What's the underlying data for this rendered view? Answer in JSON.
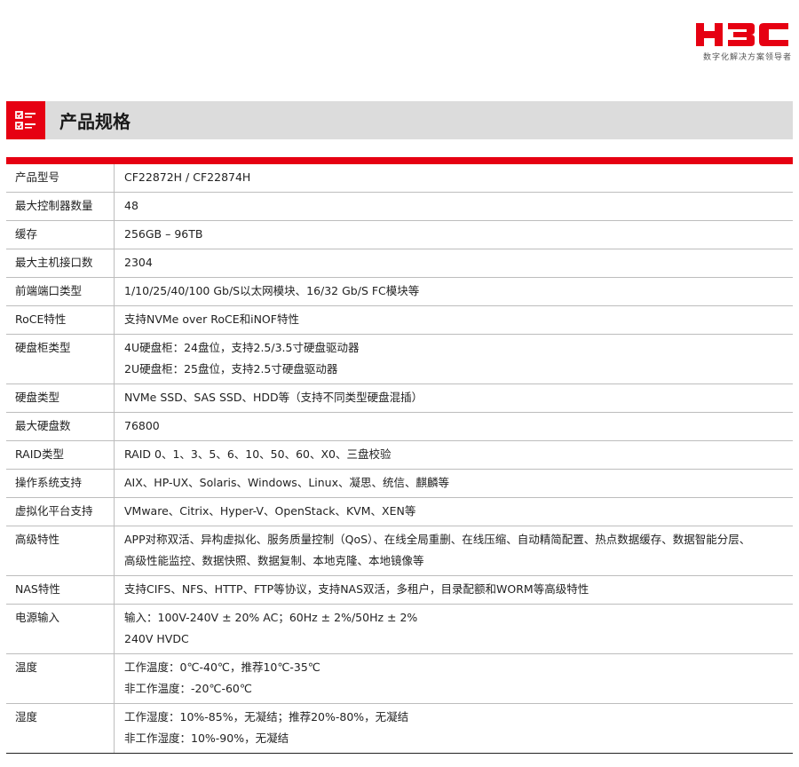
{
  "brand": {
    "logo_text": "H3C",
    "tagline": "数字化解决方案领导者",
    "accent_color": "#e60012"
  },
  "section": {
    "icon": "checklist-icon",
    "title": "产品规格"
  },
  "specs": [
    {
      "label": "产品型号",
      "lines": [
        "CF22872H  /  CF22874H"
      ]
    },
    {
      "label": "最大控制器数量",
      "lines": [
        "48"
      ]
    },
    {
      "label": "缓存",
      "lines": [
        "256GB  –  96TB"
      ]
    },
    {
      "label": "最大主机接口数",
      "lines": [
        "2304"
      ]
    },
    {
      "label": "前端端口类型",
      "lines": [
        "1/10/25/40/100 Gb/S以太网模块、16/32 Gb/S FC模块等"
      ]
    },
    {
      "label": "RoCE特性",
      "lines": [
        "支持NVMe over RoCE和iNOF特性"
      ]
    },
    {
      "label": "硬盘柜类型",
      "lines": [
        "4U硬盘柜：24盘位，支持2.5/3.5寸硬盘驱动器",
        "2U硬盘柜：25盘位，支持2.5寸硬盘驱动器"
      ]
    },
    {
      "label": "硬盘类型",
      "lines": [
        "NVMe SSD、SAS SSD、HDD等（支持不同类型硬盘混插）"
      ]
    },
    {
      "label": "最大硬盘数",
      "lines": [
        "76800"
      ]
    },
    {
      "label": "RAID类型",
      "lines": [
        "RAID 0、1、3、5、6、10、50、60、X0、三盘校验"
      ]
    },
    {
      "label": "操作系统支持",
      "lines": [
        "AIX、HP-UX、Solaris、Windows、Linux、凝思、统信、麒麟等"
      ]
    },
    {
      "label": "虚拟化平台支持",
      "lines": [
        "VMware、Citrix、Hyper-V、OpenStack、KVM、XEN等"
      ]
    },
    {
      "label": "高级特性",
      "lines": [
        "APP对称双活、异构虚拟化、服务质量控制（QoS）、在线全局重删、在线压缩、自动精简配置、热点数据缓存、数据智能分层、",
        "高级性能监控、数据快照、数据复制、本地克隆、本地镜像等"
      ]
    },
    {
      "label": "NAS特性",
      "lines": [
        "支持CIFS、NFS、HTTP、FTP等协议，支持NAS双活，多租户，目录配额和WORM等高级特性"
      ]
    },
    {
      "label": "电源输入",
      "lines": [
        "输入：100V-240V ± 20% AC；60Hz ± 2%/50Hz ± 2%",
        "240V HVDC"
      ]
    },
    {
      "label": "温度",
      "lines": [
        "工作温度：0℃-40℃，推荐10℃-35℃",
        "非工作温度：-20℃-60℃"
      ]
    },
    {
      "label": "湿度",
      "lines": [
        "工作湿度：10%-85%，无凝结；推荐20%-80%，无凝结",
        "非工作湿度：10%-90%，无凝结"
      ]
    }
  ]
}
